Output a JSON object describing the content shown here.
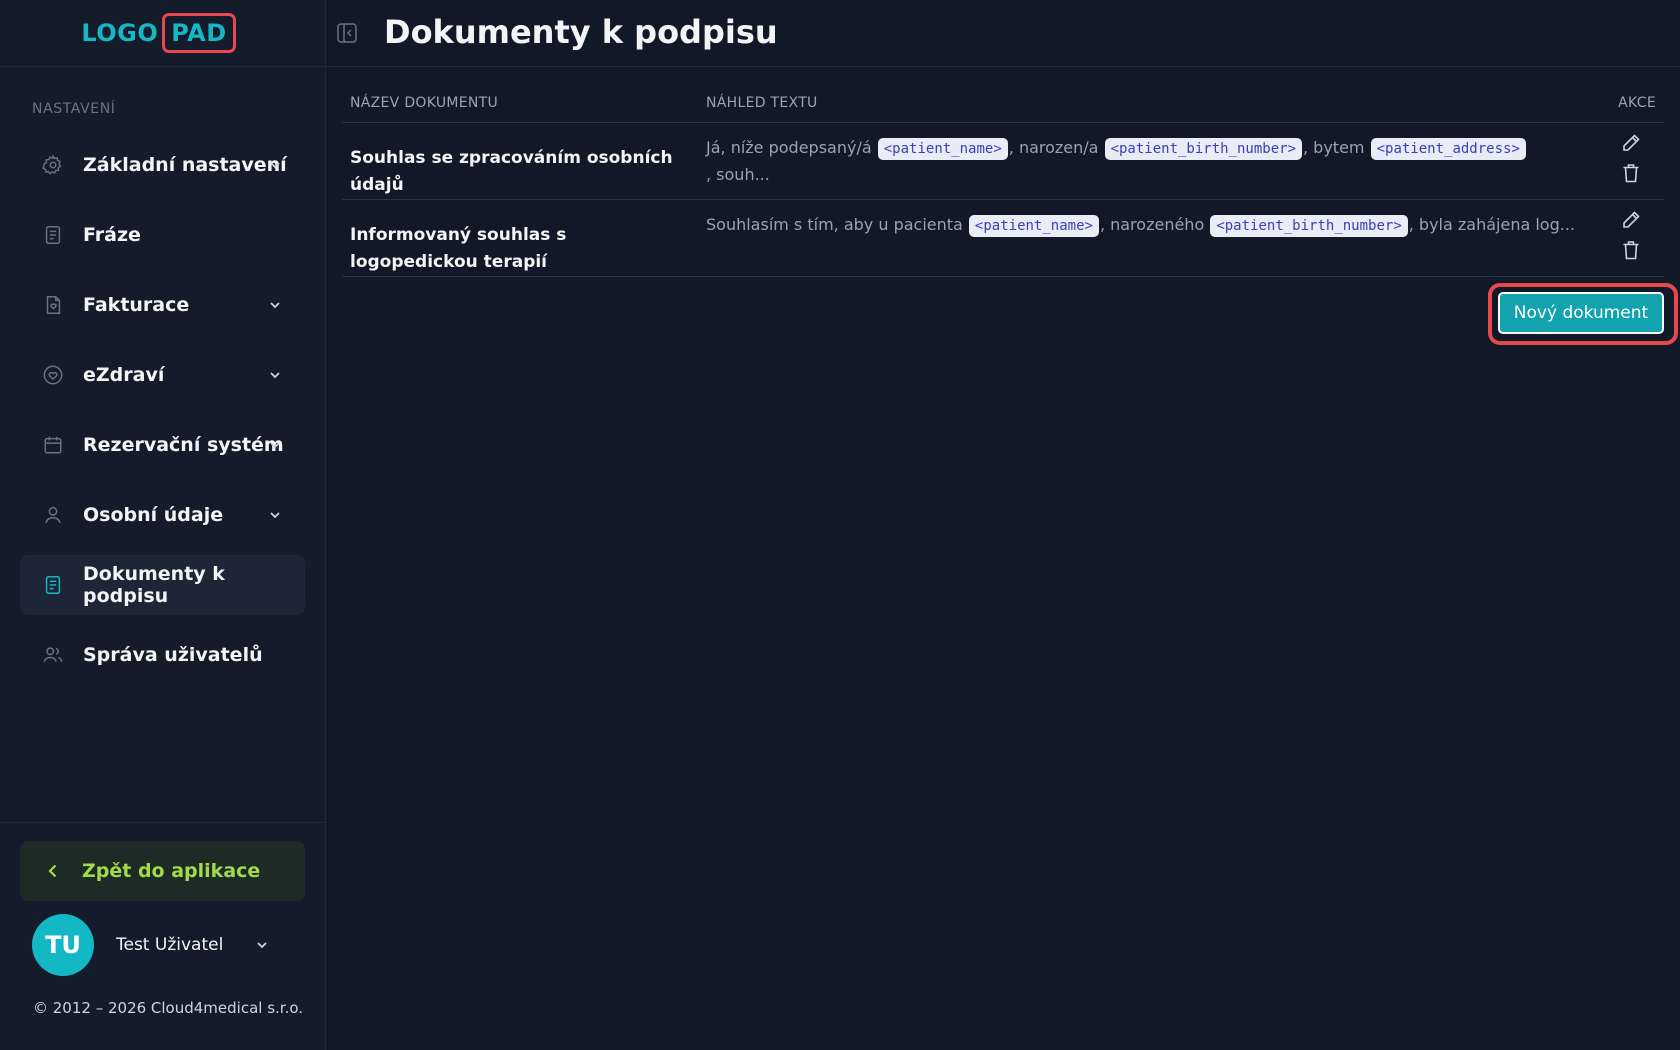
{
  "app": {
    "logo_part1": "LOGO",
    "logo_part2": "PAD"
  },
  "sidebar": {
    "section_label": "NASTAVENÍ",
    "items": [
      {
        "label": "Základní nastavení",
        "icon": "gear-icon",
        "has_chevron": true
      },
      {
        "label": "Fráze",
        "icon": "document-icon",
        "has_chevron": false
      },
      {
        "label": "Fakturace",
        "icon": "invoice-icon",
        "has_chevron": true
      },
      {
        "label": "eZdraví",
        "icon": "heart-icon",
        "has_chevron": true
      },
      {
        "label": "Rezervační systém",
        "icon": "calendar-icon",
        "has_chevron": true
      },
      {
        "label": "Osobní údaje",
        "icon": "user-icon",
        "has_chevron": true
      },
      {
        "label": "Dokumenty k podpisu",
        "icon": "document-icon",
        "has_chevron": false,
        "active": true
      },
      {
        "label": "Správa uživatelů",
        "icon": "users-icon",
        "has_chevron": false
      }
    ],
    "back_label": "Zpět do aplikace",
    "user": {
      "initials": "TU",
      "name": "Test Uživatel"
    },
    "copyright": "© 2012 – 2026 Cloud4medical s.r.o."
  },
  "header": {
    "title": "Dokumenty k podpisu"
  },
  "table": {
    "columns": [
      "NÁZEV DOKUMENTU",
      "NÁHLED TEXTU",
      "AKCE"
    ],
    "rows": [
      {
        "name": "Souhlas se zpracováním osobních údajů",
        "preview": {
          "t1": "Já, níže podepsaný/á ",
          "tag1": "<patient_name>",
          "t2": ", narozen/a ",
          "tag2": "<patient_birth_number>",
          "t3": ", bytem ",
          "tag3": "<patient_address>",
          "t4": ", souh..."
        }
      },
      {
        "name": "Informovaný souhlas s logopedickou terapií",
        "preview": {
          "t1": "Souhlasím s tím, aby u pacienta ",
          "tag1": "<patient_name>",
          "t2": ", narozeného ",
          "tag2": "<patient_birth_number>",
          "t3": ", byla zahájena log..."
        }
      }
    ]
  },
  "actions": {
    "new_document_label": "Nový dokument"
  },
  "colors": {
    "accent": "#14b8c4",
    "highlight": "#e5484d",
    "back_green": "#a3d94a",
    "background": "#111827"
  }
}
